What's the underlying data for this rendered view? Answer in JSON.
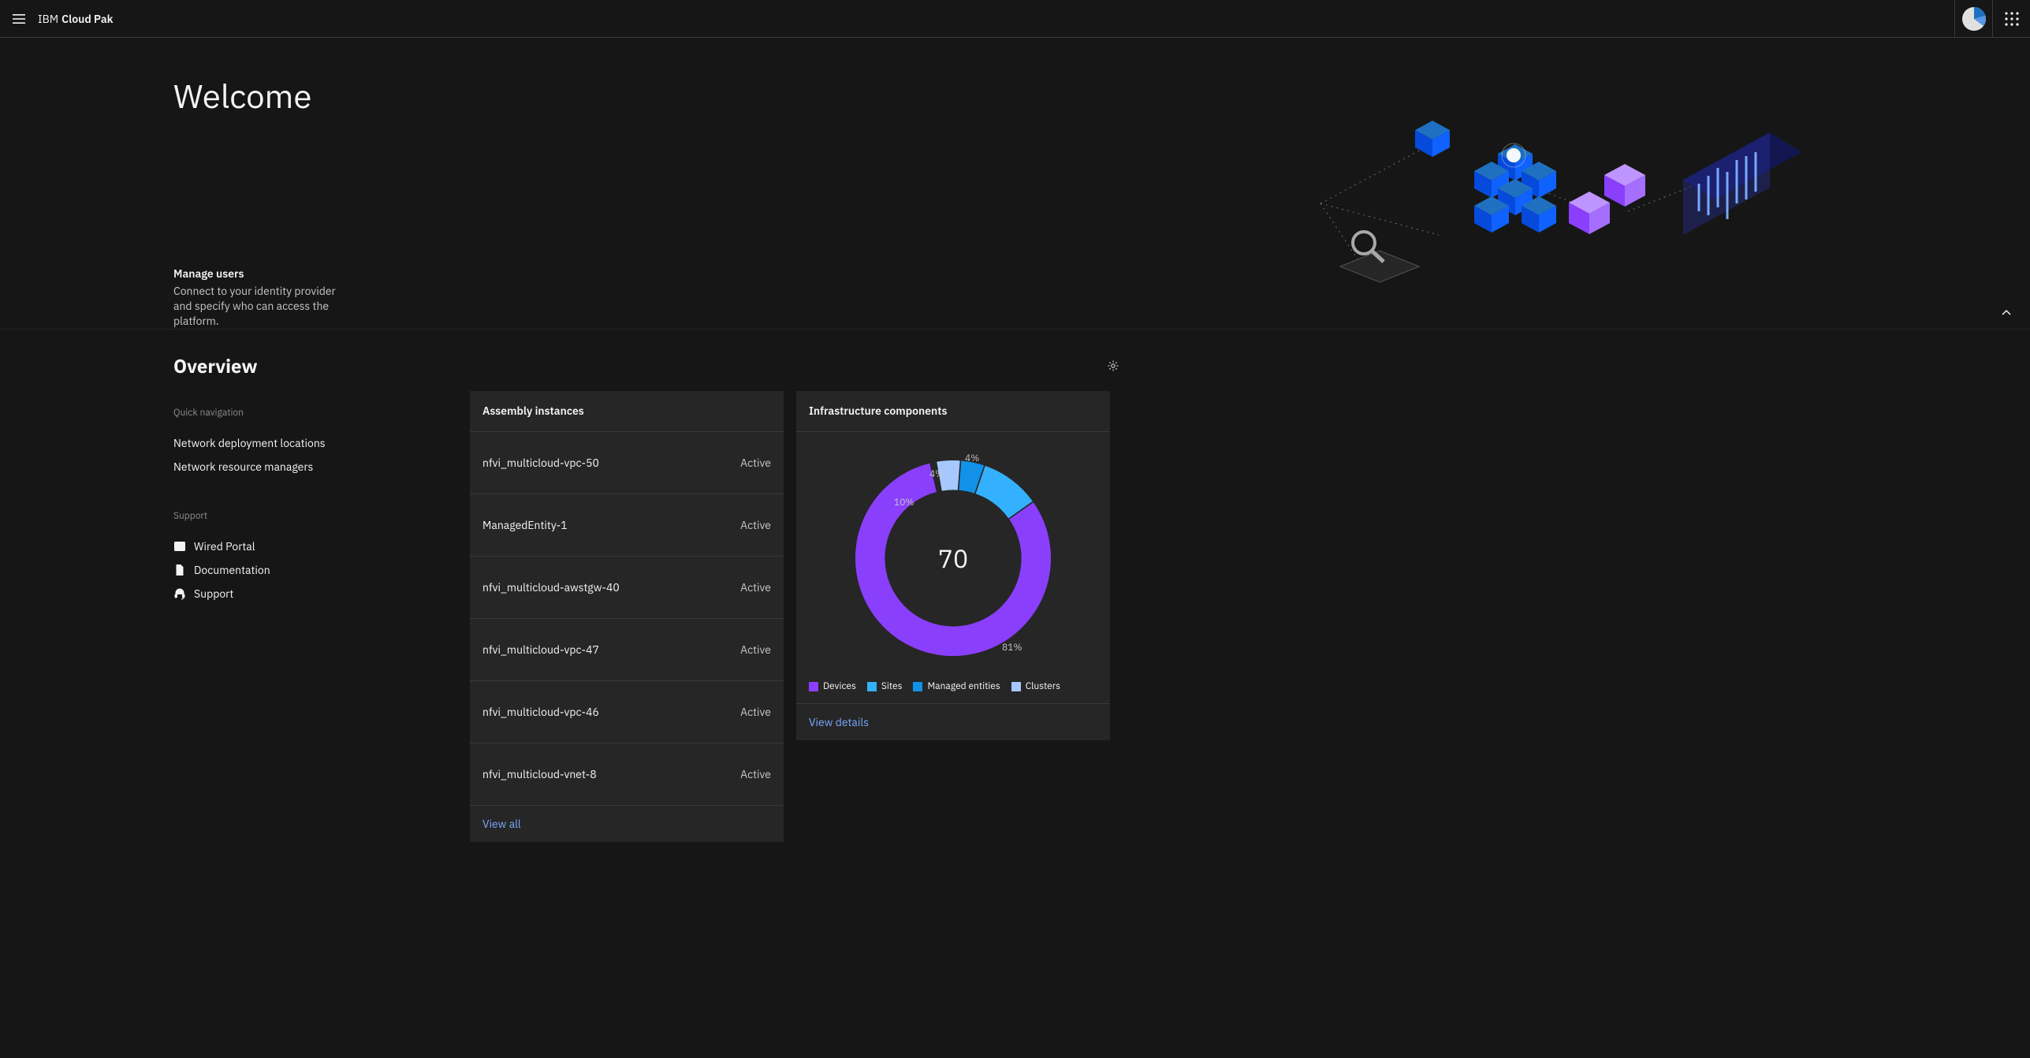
{
  "header": {
    "brand_prefix": "IBM",
    "brand_suffix": "Cloud Pak"
  },
  "hero": {
    "title": "Welcome",
    "card_title": "Manage users",
    "card_body": "Connect to your identity provider and specify who can access the platform."
  },
  "overview": {
    "title": "Overview",
    "quicknav_label": "Quick navigation",
    "quicknav": [
      "Network deployment locations",
      "Network resource managers"
    ],
    "support_label": "Support",
    "support_items": [
      {
        "name": "Wired Portal",
        "icon": "terminal-icon"
      },
      {
        "name": "Documentation",
        "icon": "document-icon"
      },
      {
        "name": "Support",
        "icon": "headset-icon"
      }
    ]
  },
  "assembly": {
    "title": "Assembly instances",
    "rows": [
      {
        "name": "nfvi_multicloud-vpc-50",
        "status": "Active"
      },
      {
        "name": "ManagedEntity-1",
        "status": "Active"
      },
      {
        "name": "nfvi_multicloud-awstgw-40",
        "status": "Active"
      },
      {
        "name": "nfvi_multicloud-vpc-47",
        "status": "Active"
      },
      {
        "name": "nfvi_multicloud-vpc-46",
        "status": "Active"
      },
      {
        "name": "nfvi_multicloud-vnet-8",
        "status": "Active"
      }
    ],
    "footer": "View all"
  },
  "infra": {
    "title": "Infrastructure components",
    "total": "70",
    "labels": {
      "a": "4%",
      "b": "4%",
      "c": "10%",
      "d": "81%"
    },
    "legend": [
      {
        "name": "Devices",
        "color": "#8a3ffc"
      },
      {
        "name": "Sites",
        "color": "#33b1ff"
      },
      {
        "name": "Managed entities",
        "color": "#1192e8"
      },
      {
        "name": "Clusters",
        "color": "#a6c8ff"
      }
    ],
    "footer": "View details"
  },
  "chart_data": {
    "type": "pie",
    "title": "Infrastructure components",
    "total": 70,
    "series": [
      {
        "name": "Devices",
        "percent": 81,
        "color": "#8a3ffc"
      },
      {
        "name": "Sites",
        "percent": 10,
        "color": "#33b1ff"
      },
      {
        "name": "Managed entities",
        "percent": 4,
        "color": "#1192e8"
      },
      {
        "name": "Clusters",
        "percent": 4,
        "color": "#a6c8ff"
      }
    ]
  }
}
